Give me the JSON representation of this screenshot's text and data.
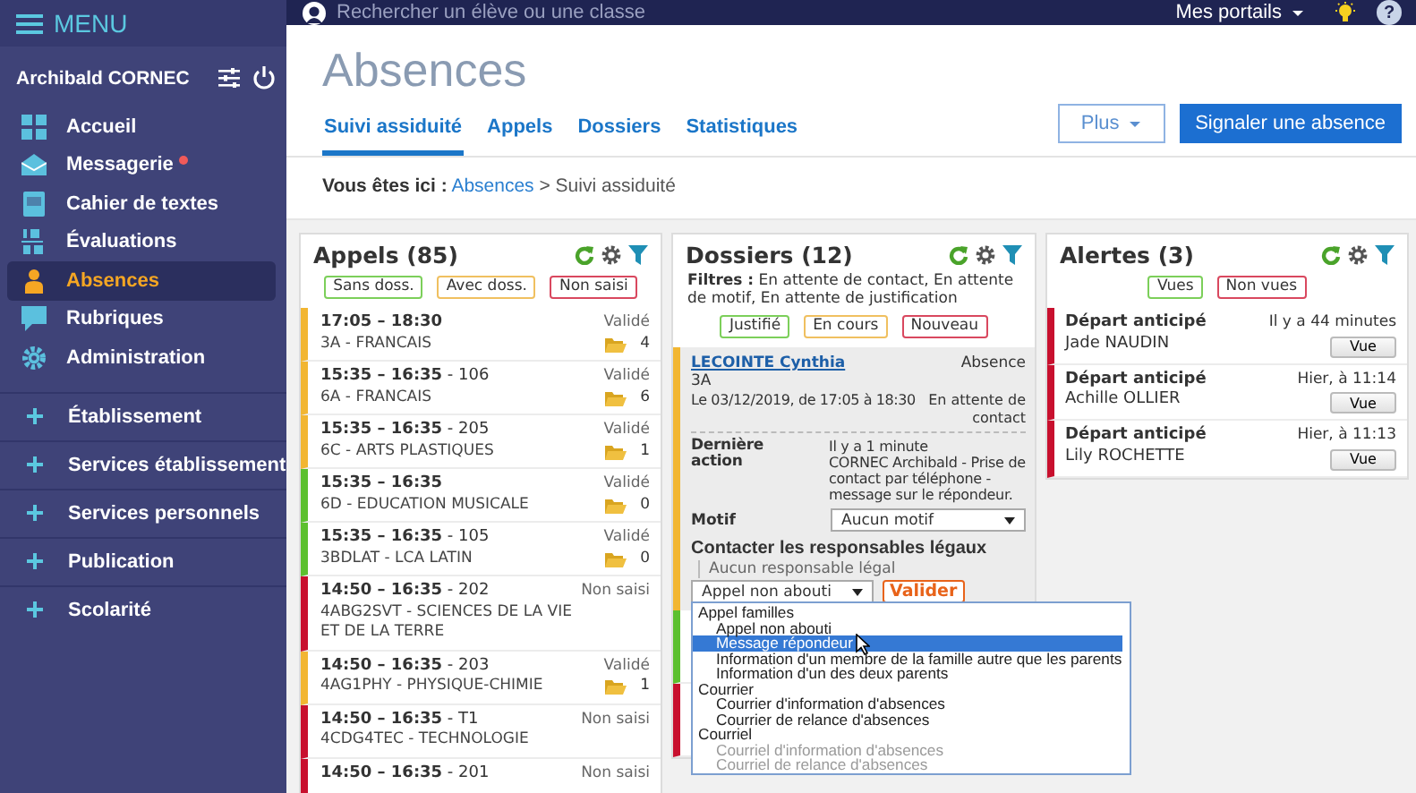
{
  "topbar": {
    "menu_label": "MENU",
    "search_placeholder": "Rechercher un élève ou une classe",
    "portals": "Mes portails",
    "help": "?"
  },
  "sidebar": {
    "user": "Archibald CORNEC",
    "items": [
      {
        "label": "Accueil",
        "kind": "grid",
        "selected": false,
        "notification": false
      },
      {
        "label": "Messagerie",
        "kind": "envelope",
        "selected": false,
        "notification": true
      },
      {
        "label": "Cahier de textes",
        "kind": "book",
        "selected": false,
        "notification": false
      },
      {
        "label": "Évaluations",
        "kind": "score",
        "selected": false,
        "notification": false
      },
      {
        "label": "Absences",
        "kind": "person",
        "selected": true,
        "notification": false
      },
      {
        "label": "Rubriques",
        "kind": "chat",
        "selected": false,
        "notification": false
      },
      {
        "label": "Administration",
        "kind": "gear",
        "selected": false,
        "notification": false
      }
    ],
    "sections": [
      {
        "label": "Établissement",
        "expanded": false
      },
      {
        "label": "Services établissement",
        "expanded": false
      },
      {
        "label": "Services personnels",
        "expanded": false
      },
      {
        "label": "Publication",
        "expanded": false
      },
      {
        "label": "Scolarité",
        "expanded": false
      }
    ]
  },
  "header": {
    "title": "Absences",
    "tabs": [
      {
        "label": "Suivi assiduité",
        "selected": true
      },
      {
        "label": "Appels",
        "selected": false
      },
      {
        "label": "Dossiers",
        "selected": false
      },
      {
        "label": "Statistiques",
        "selected": false
      }
    ],
    "more_button": "Plus",
    "primary_button": "Signaler une absence"
  },
  "breadcrumb": {
    "prefix": "Vous êtes ici :",
    "link": "Absences",
    "separator": ">",
    "current": "Suivi assiduité"
  },
  "appels": {
    "title": "Appels (85)",
    "chips": [
      {
        "label": "Sans doss.",
        "color": "#7ccf5a"
      },
      {
        "label": "Avec doss.",
        "color": "#f0c060"
      },
      {
        "label": "Non saisi",
        "color": "#d9485f"
      }
    ],
    "rows": [
      {
        "time": "17:05 – 18:30",
        "room": "",
        "class": "3A - FRANCAIS",
        "status": "Validé",
        "files": "4",
        "color": "#f2b632"
      },
      {
        "time": "15:35 – 16:35",
        "room": "- 106",
        "class": "6A - FRANCAIS",
        "status": "Validé",
        "files": "6",
        "color": "#f2b632"
      },
      {
        "time": "15:35 – 16:35",
        "room": "- 205",
        "class": "6C - ARTS PLASTIQUES",
        "status": "Validé",
        "files": "1",
        "color": "#f2b632"
      },
      {
        "time": "15:35 – 16:35",
        "room": "",
        "class": "6D - EDUCATION MUSICALE",
        "status": "Validé",
        "files": "0",
        "color": "#5cc02f"
      },
      {
        "time": "15:35 – 16:35",
        "room": "- 105",
        "class": "3BDLAT - LCA LATIN",
        "status": "Validé",
        "files": "0",
        "color": "#5cc02f"
      },
      {
        "time": "14:50 – 16:35",
        "room": "- 202",
        "class": "4ABG2SVT - SCIENCES DE LA VIE ET DE LA TERRE",
        "status": "Non saisi",
        "files": "",
        "color": "#c8102e"
      },
      {
        "time": "14:50 – 16:35",
        "room": "- 203",
        "class": "4AG1PHY - PHYSIQUE-CHIMIE",
        "status": "Validé",
        "files": "1",
        "color": "#f2b632"
      },
      {
        "time": "14:50 – 16:35",
        "room": "- T1",
        "class": "4CDG4TEC - TECHNOLOGIE",
        "status": "Non saisi",
        "files": "",
        "color": "#c8102e"
      },
      {
        "time": "14:50 – 16:35",
        "room": "- 201",
        "class": "",
        "status": "Non saisi",
        "files": "",
        "color": "#c8102e"
      }
    ]
  },
  "dossiers": {
    "title": "Dossiers (12)",
    "filters_label": "Filtres :",
    "filters": "En attente de contact, En attente de motif, En attente de justification",
    "chips": [
      {
        "label": "Justifié",
        "color": "#7ccf5a"
      },
      {
        "label": "En cours",
        "color": "#f0c060"
      },
      {
        "label": "Nouveau",
        "color": "#d9485f"
      }
    ],
    "card": {
      "student": "LECOINTE Cynthia",
      "type": "Absence",
      "class": "3A",
      "date": "Le 03/12/2019, de 17:05 à 18:30",
      "status": "En attente de contact",
      "color": "#f2b632",
      "last_action_label": "Dernière action",
      "last_action_time": "Il y a 1 minute",
      "last_action_text": "CORNEC Archibald - Prise de contact par téléphone - message sur le répondeur.",
      "motif_label": "Motif",
      "motif_value": "Aucun motif",
      "contact_title": "Contacter les responsables légaux",
      "no_contact": "Aucun responsable légal",
      "contact_value": "Appel non abouti",
      "validate": "Valider",
      "dropdown": [
        {
          "label": "Appel familles",
          "options": [
            {
              "label": "Appel non abouti",
              "selected": false,
              "disabled": false
            },
            {
              "label": "Message répondeur",
              "selected": true,
              "disabled": false
            },
            {
              "label": "Information d'un membre de la famille autre que les parents",
              "selected": false,
              "disabled": false
            },
            {
              "label": "Information d'un des deux parents",
              "selected": false,
              "disabled": false
            }
          ]
        },
        {
          "label": "Courrier",
          "options": [
            {
              "label": "Courrier d'information d'absences",
              "selected": false,
              "disabled": false
            },
            {
              "label": "Courrier de relance d'absences",
              "selected": false,
              "disabled": false
            }
          ]
        },
        {
          "label": "Courriel",
          "options": [
            {
              "label": "Courriel d'information d'absences",
              "selected": false,
              "disabled": true
            },
            {
              "label": "Courriel de relance d'absences",
              "selected": false,
              "disabled": true
            }
          ]
        }
      ]
    },
    "more_items": [
      {
        "color": "#5cc02f"
      },
      {
        "color": "#c8102e"
      }
    ]
  },
  "alertes": {
    "title": "Alertes (3)",
    "chips": [
      {
        "label": "Vues",
        "color": "#7ccf5a"
      },
      {
        "label": "Non vues",
        "color": "#d9485f"
      }
    ],
    "rows": [
      {
        "title": "Départ anticipé",
        "student": "Jade NAUDIN",
        "time": "Il y a 44 minutes",
        "button": "Vue",
        "color": "#c8102e"
      },
      {
        "title": "Départ anticipé",
        "student": "Achille OLLIER",
        "time": "Hier, à 11:14",
        "button": "Vue",
        "color": "#c8102e"
      },
      {
        "title": "Départ anticipé",
        "student": "Lily ROCHETTE",
        "time": "Hier, à 11:13",
        "button": "Vue",
        "color": "#c8102e"
      }
    ]
  }
}
